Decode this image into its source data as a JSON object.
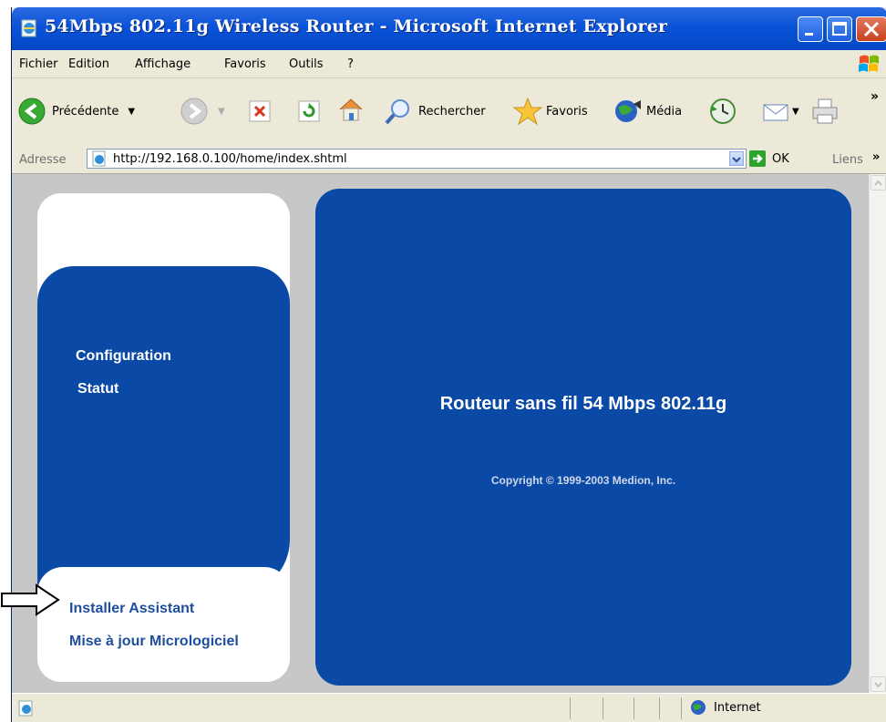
{
  "window": {
    "title": "54Mbps 802.11g Wireless Router - Microsoft Internet Explorer"
  },
  "menubar": {
    "items": [
      "Fichier",
      "Edition",
      "Affichage",
      "Favoris",
      "Outils",
      "?"
    ]
  },
  "toolbar": {
    "back_label": "Précédente",
    "search_label": "Rechercher",
    "favorites_label": "Favoris",
    "media_label": "Média"
  },
  "addressbar": {
    "label": "Adresse",
    "url": "http://192.168.0.100/home/index.shtml",
    "go_label": "OK",
    "links_label": "Liens"
  },
  "sidebar": {
    "top_items": [
      "Configuration",
      "Statut"
    ],
    "bottom_items": [
      "Installer Assistant",
      "Mise à jour Micrologiciel"
    ]
  },
  "main": {
    "title": "Routeur sans fil 54 Mbps 802.11g",
    "copyright": "Copyright © 1999-2003 Medion, Inc."
  },
  "statusbar": {
    "zone": "Internet"
  },
  "colors": {
    "panel_blue": "#0a4aa6",
    "page_gray": "#c7c7c7",
    "link_blue": "#1f4e9c"
  }
}
